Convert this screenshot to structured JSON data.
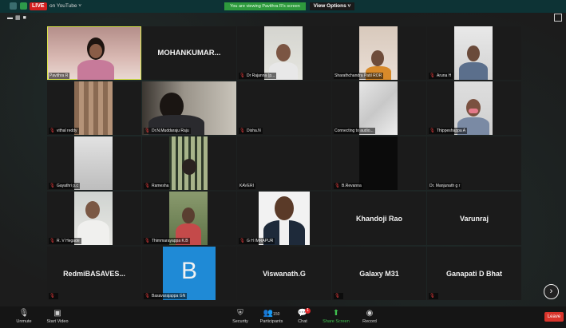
{
  "topbar": {
    "live_label": "LIVE",
    "youtube_label": "on YouTube",
    "share_banner": "You are viewing Pavithra R's screen",
    "view_options": "View Options ˅"
  },
  "participants": [
    {
      "name": "Pavithra R",
      "label": "Pavithra R"
    },
    {
      "name": "MOHANKUMAR...",
      "label": ""
    },
    {
      "name": "Dr Rajanna",
      "label": "Dr Rajanna (p..."
    },
    {
      "name": "Sharathchandra",
      "label": "Sharathchandra Patil ROR"
    },
    {
      "name": "Aruna H",
      "label": "Aruna H"
    },
    {
      "name": "vithal reddy",
      "label": "vithal reddy"
    },
    {
      "name": "Dr.N.Muddaraju Raju",
      "label": "Dr.N.Muddaraju Raju"
    },
    {
      "name": "Disha.N",
      "label": "Disha.N"
    },
    {
      "name": "Connecting",
      "label": "Connecting to audio..."
    },
    {
      "name": "Thippeshappa",
      "label": "Thippeshappa A"
    },
    {
      "name": "Gayathri",
      "label": "Gayathri p.c"
    },
    {
      "name": "Ramesha",
      "label": "Ramesha"
    },
    {
      "name": "KAVERI",
      "label": "KAVERI"
    },
    {
      "name": "B.Revanna",
      "label": "B.Revanna"
    },
    {
      "name": "Dr. Manjunath",
      "label": "Dr. Manjunath g r"
    },
    {
      "name": "R. V Hegade",
      "label": "R. V Hegade"
    },
    {
      "name": "Thimmarayappa",
      "label": "Thimmarayappa K.B"
    },
    {
      "name": "G H IMRAPUR",
      "label": "G H IMRAPUR"
    },
    {
      "name": "Khandoji Rao",
      "label": ""
    },
    {
      "name": "Varunraj",
      "label": ""
    },
    {
      "name": "RedmiBASAVES...",
      "label": ""
    },
    {
      "name": "Basavarajappa GN",
      "label": "Basavarajappa GN",
      "avatar_letter": "B"
    },
    {
      "name": "Viswanath.G",
      "label": ""
    },
    {
      "name": "Galaxy M31",
      "label": ""
    },
    {
      "name": "Ganapati D Bhat",
      "label": ""
    }
  ],
  "toolbar": {
    "unmute": "Unmute",
    "start_video": "Start Video",
    "security": "Security",
    "participants": "Participants",
    "participants_count": "150",
    "chat": "Chat",
    "chat_badge": "1",
    "share_screen": "Share Screen",
    "record": "Record",
    "leave": "Leave"
  },
  "colors": {
    "accent_green": "#2e9a3d",
    "live_red": "#d21f1f",
    "leave_red": "#d9342b",
    "avatar_blue": "#1f8ad6",
    "active_speaker": "#d8e24a"
  }
}
